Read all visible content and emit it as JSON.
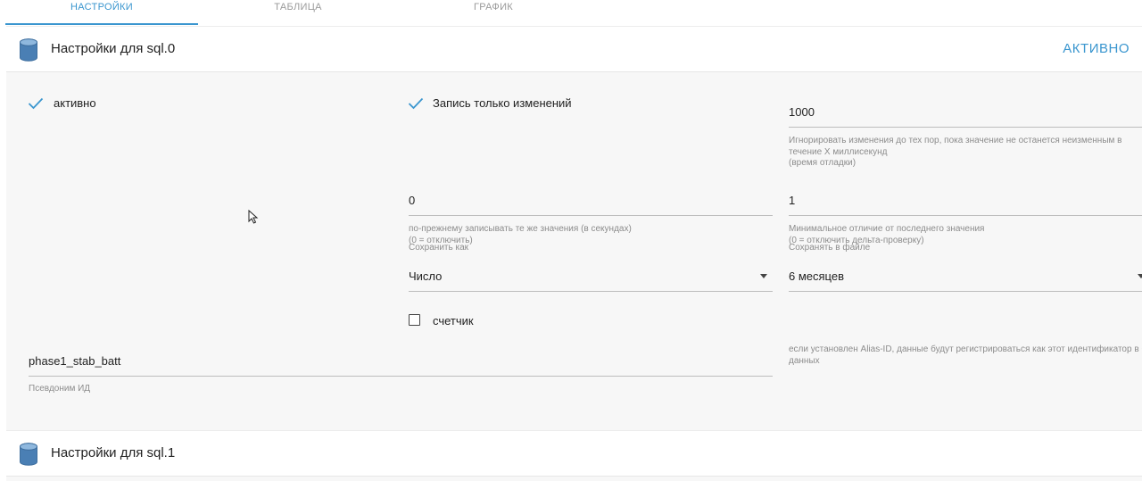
{
  "tabs": [
    {
      "label": "НАСТРОЙКИ",
      "active": true
    },
    {
      "label": "ТАБЛИЦА",
      "active": false
    },
    {
      "label": "ГРАФИК",
      "active": false
    }
  ],
  "panel0": {
    "title": "Настройки для sql.0",
    "status": "АКТИВНО",
    "enabled_label": "активно",
    "changes_only_label": "Запись только изменений",
    "debounce": {
      "value": "1000",
      "help_line1": "Игнорировать изменения до тех пор, пока значение не останется неизменным в",
      "help_line2": "течение X миллисекунд",
      "help_line3": "(время отладки)"
    },
    "retention_same": {
      "value": "0",
      "help_line1": "по-прежнему записывать те же значения (в секундах)",
      "help_line2": "(0 = отключить)"
    },
    "min_diff": {
      "value": "1",
      "help_line1": "Минимальное отличие от последнего значения",
      "help_line2": "(0 = отключить дельта-проверку)"
    },
    "store_as": {
      "label": "Сохранить как",
      "value": "Число"
    },
    "storage": {
      "label": "Сохранять в файле",
      "value": "6 месяцев"
    },
    "counter_label": "счетчик",
    "alias": {
      "value": "phase1_stab_batt",
      "label": "Псевдоним ИД",
      "help_line1": "если установлен Alias-ID, данные будут регистрироваться как этот идентификатор в ба",
      "help_line2": "данных"
    }
  },
  "panel1": {
    "title": "Настройки для sql.1"
  },
  "colors": {
    "accent": "#3a96cf",
    "db_icon": "#4a7fb4"
  }
}
